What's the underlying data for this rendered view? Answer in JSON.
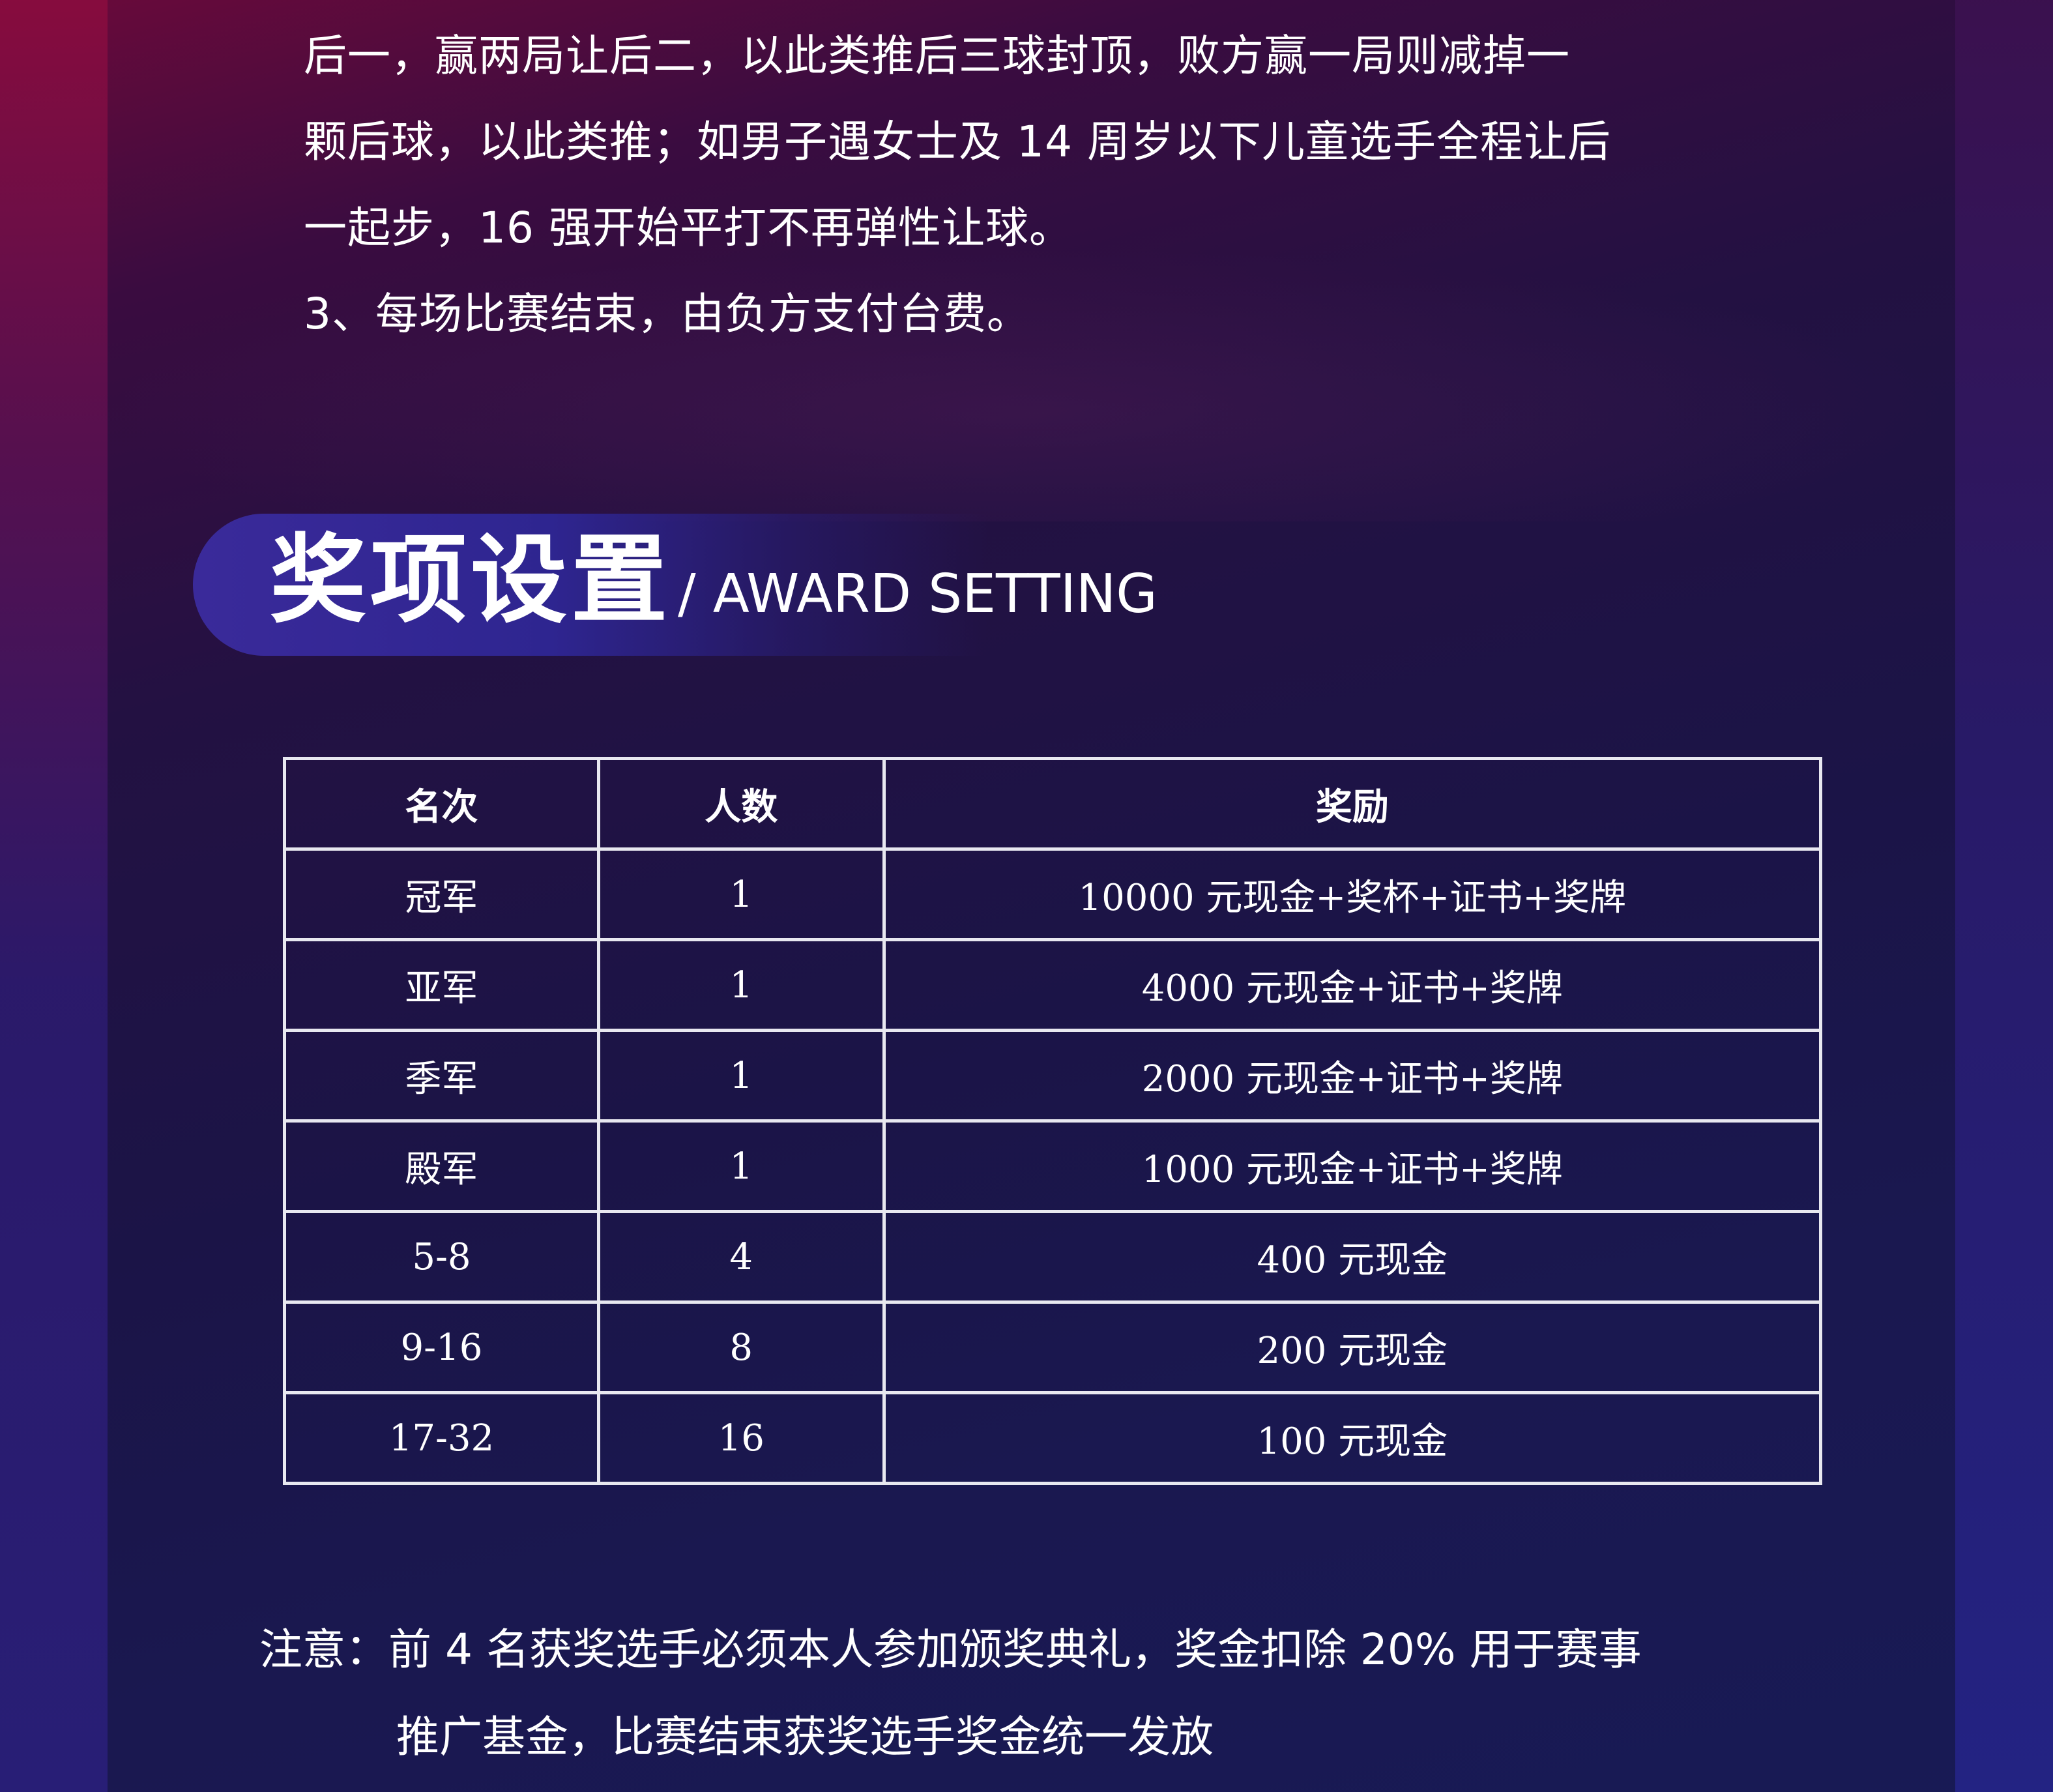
{
  "intro": {
    "lines": [
      "后一，赢两局让后二，以此类推后三球封顶，败方赢一局则减掉一",
      "颗后球，以此类推；如男子遇女士及 14 周岁以下儿童选手全程让后",
      "一起步，16 强开始平打不再弹性让球。",
      "3、每场比赛结束，由负方支付台费。"
    ]
  },
  "section": {
    "title_cn": "奖项设置",
    "title_en": "/ AWARD SETTING"
  },
  "table": {
    "headers": [
      "名次",
      "人数",
      "奖励"
    ],
    "rows": [
      [
        "冠军",
        "1",
        "10000 元现金+奖杯+证书+奖牌"
      ],
      [
        "亚军",
        "1",
        "4000 元现金+证书+奖牌"
      ],
      [
        "季军",
        "1",
        "2000 元现金+证书+奖牌"
      ],
      [
        "殿军",
        "1",
        "1000 元现金+证书+奖牌"
      ],
      [
        "5-8",
        "4",
        "400 元现金"
      ],
      [
        "9-16",
        "8",
        "200 元现金"
      ],
      [
        "17-32",
        "16",
        "100 元现金"
      ]
    ]
  },
  "note": {
    "line1": "注意：前 4 名获奖选手必须本人参加颁奖典礼，奖金扣除 20% 用于赛事",
    "line2": "推广基金，比赛结束获奖选手奖金统一发放"
  },
  "colors": {
    "background": "#1a1145",
    "banner": "#3a2a9a",
    "table_border": "#e8e8f0",
    "text": "#ffffff"
  }
}
